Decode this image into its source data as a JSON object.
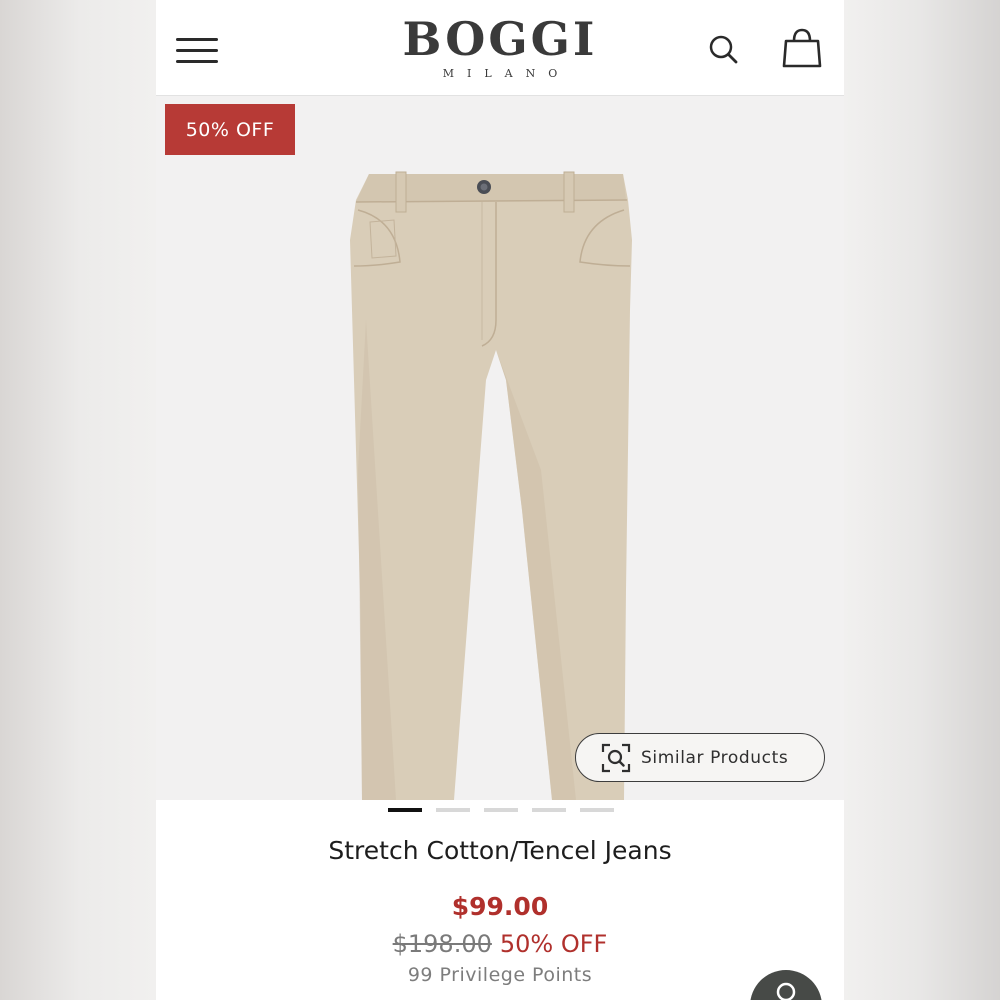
{
  "header": {
    "brand": "BOGGI",
    "brand_sub": "MILANO",
    "menu_icon": "hamburger-menu-icon",
    "search_icon": "search-icon",
    "bag_icon": "shopping-bag-icon"
  },
  "product_image": {
    "badge": "50% OFF",
    "badge_color": "#b73a36",
    "similar_products_label": "Similar Products",
    "similar_icon": "visual-search-icon"
  },
  "carousel": {
    "total": 5,
    "active_index": 0
  },
  "product": {
    "title": "Stretch Cotton/Tencel Jeans",
    "price": "$99.00",
    "original_price": "$198.00",
    "discount": "50% OFF",
    "points": "99 Privilege Points",
    "accent_color": "#b0302c"
  },
  "chat": {
    "icon": "chat-icon"
  }
}
